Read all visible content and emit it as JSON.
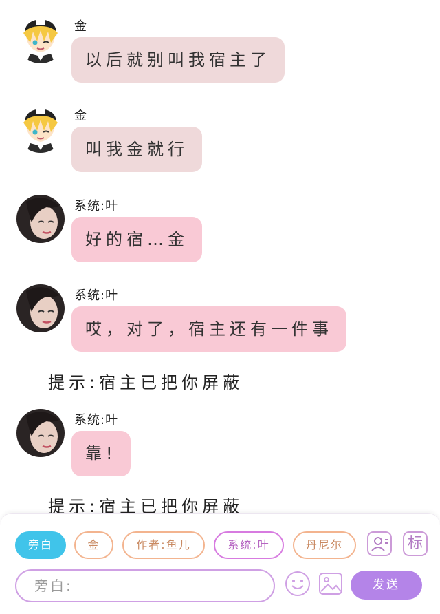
{
  "messages": [
    {
      "sender": "金",
      "text": "以后就别叫我宿主了",
      "avatar": "blonde-anime-boy-avatar"
    },
    {
      "sender": "金",
      "text": "叫我金就行",
      "avatar": "blonde-anime-boy-avatar"
    },
    {
      "sender": "系统:叶",
      "text": "好的宿…金",
      "avatar": "girl-photo-avatar"
    },
    {
      "sender": "系统:叶",
      "text": "哎，对了，宿主还有一件事",
      "avatar": "girl-photo-avatar"
    }
  ],
  "notice1": "提示:宿主已把你屏蔽",
  "message5": {
    "sender": "系统:叶",
    "text": "靠!",
    "avatar": "girl-photo-avatar"
  },
  "notice2": "提示:宿主已把你屏蔽",
  "roles": {
    "narration": "旁白",
    "jin": "金",
    "author": "作者:鱼儿",
    "system": "系统:叶",
    "dannier": "丹尼尔"
  },
  "tag_icon_label": "标",
  "input": {
    "placeholder": "旁白:"
  },
  "send_label": "发送",
  "colors": {
    "jin_bubble": "#efd9da",
    "ye_bubble": "#f9c9d5",
    "active_chip": "#40c4ea",
    "send_button": "#b484e8"
  }
}
